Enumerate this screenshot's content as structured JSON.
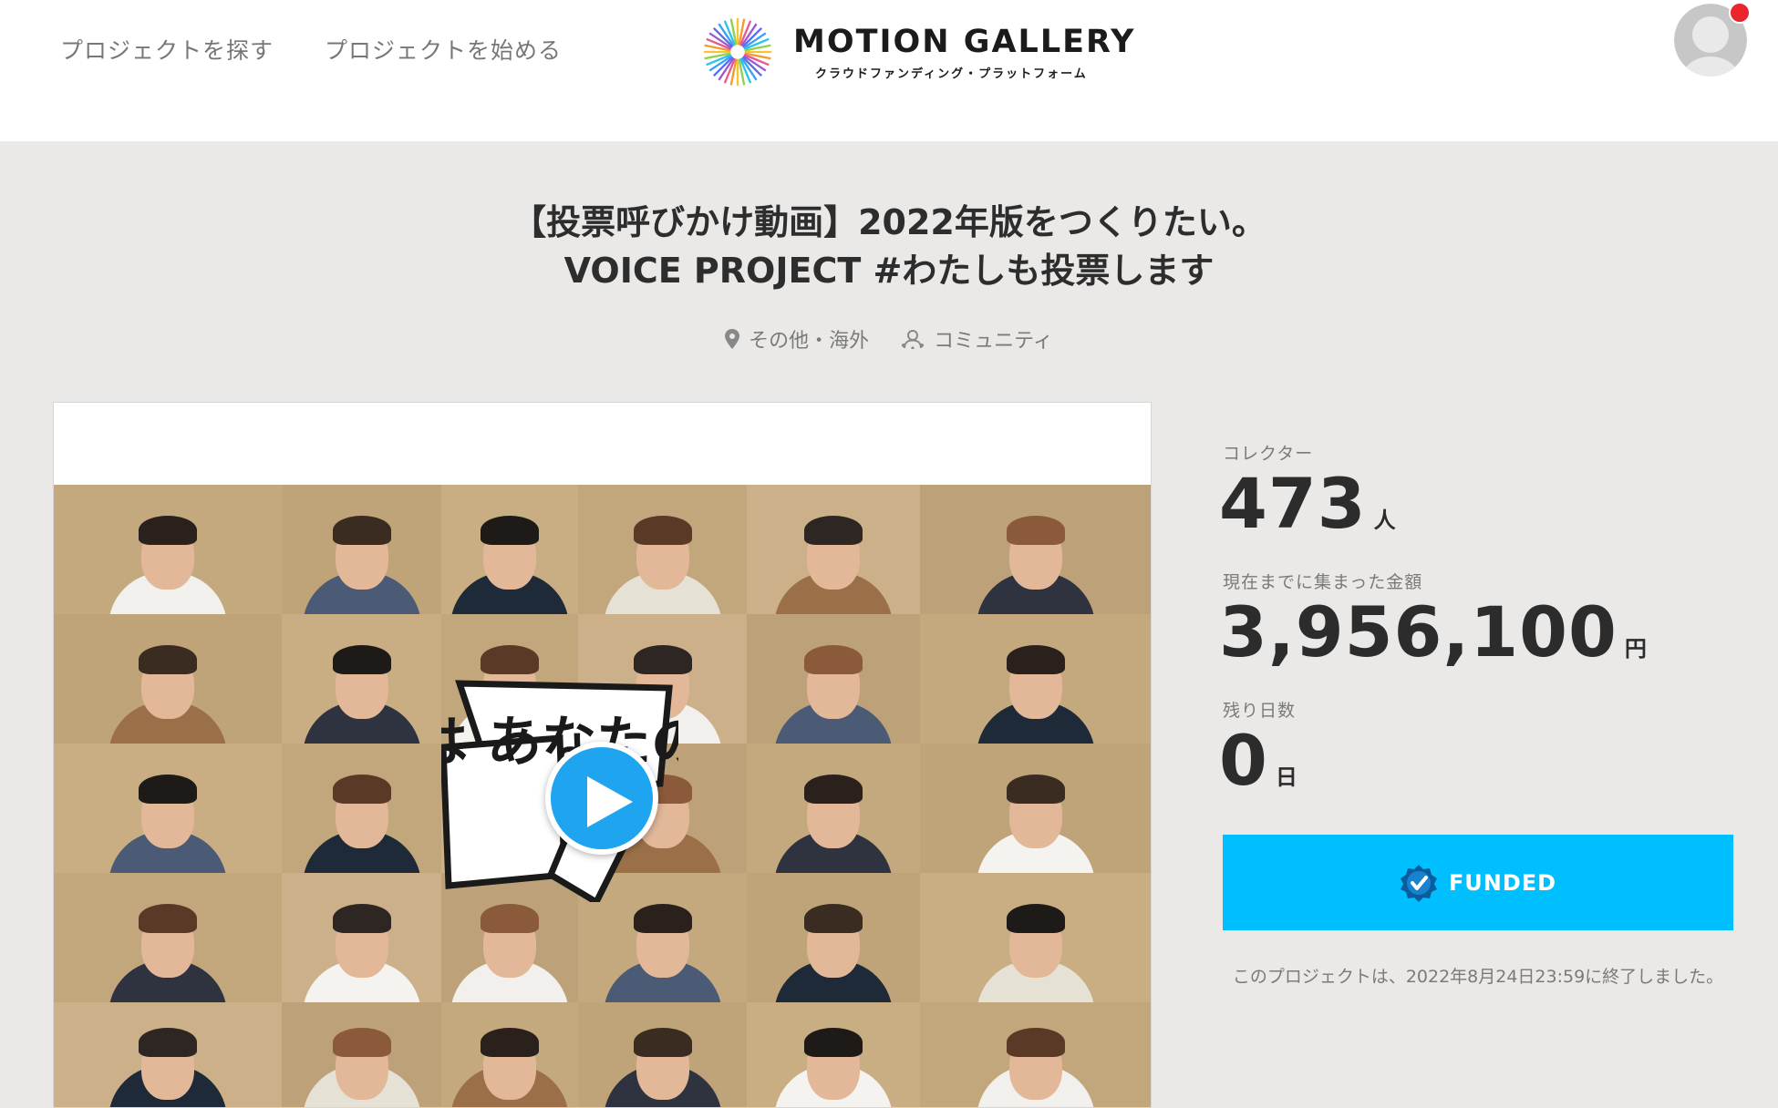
{
  "header": {
    "nav": {
      "explore": "プロジェクトを探す",
      "start": "プロジェクトを始める"
    },
    "logo": {
      "title": "MOTION GALLERY",
      "subtitle": "クラウドファンディング・プラットフォーム"
    },
    "avatar_icon": "user-avatar-icon",
    "notification_color": "#e8262b"
  },
  "project": {
    "title_line1": "【投票呼びかけ動画】2022年版をつくりたい。",
    "title_line2": "VOICE PROJECT #わたしも投票します",
    "tags": {
      "location": "その他・海外",
      "category": "コミュニティ"
    },
    "video": {
      "sign_text": "投票は あなたの 声",
      "play_icon": "play-icon"
    }
  },
  "stats": {
    "collectors_label": "コレクター",
    "collectors_value": "473",
    "collectors_unit": "人",
    "amount_label": "現在までに集まった金額",
    "amount_value": "3,956,100",
    "amount_unit": "円",
    "days_label": "残り日数",
    "days_value": "0",
    "days_unit": "日"
  },
  "funded": {
    "label": "FUNDED",
    "icon": "check-badge-icon",
    "color": "#00bfff"
  },
  "end_note": "このプロジェクトは、2022年8月24日23:59に終了しました。"
}
